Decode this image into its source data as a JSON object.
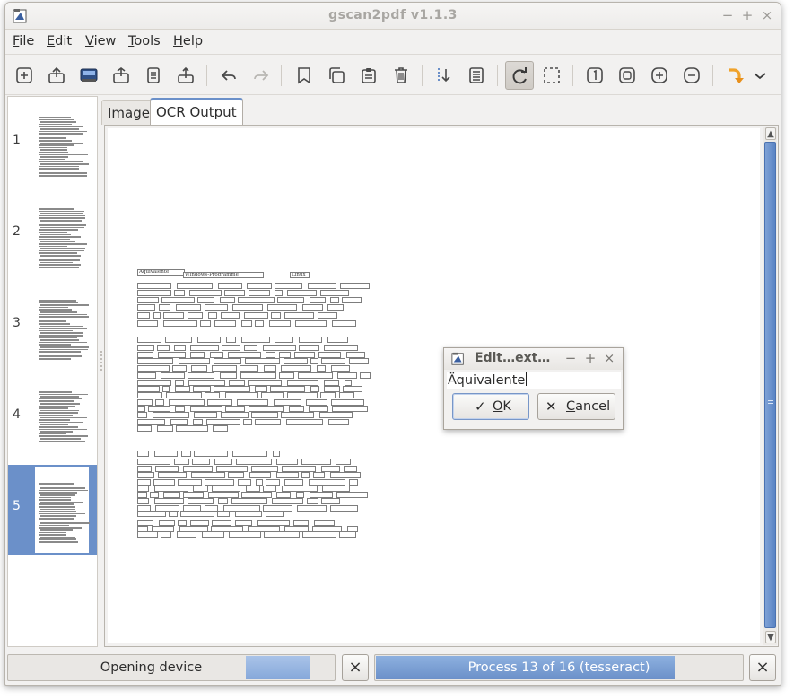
{
  "window": {
    "title": "gscan2pdf v1.1.3",
    "controls": {
      "minimize": "−",
      "maximize": "+",
      "close": "×"
    }
  },
  "menubar": {
    "items": [
      {
        "label": "File",
        "mnemonic": "F",
        "rest": "ile"
      },
      {
        "label": "Edit",
        "mnemonic": "E",
        "rest": "dit"
      },
      {
        "label": "View",
        "mnemonic": "V",
        "rest": "iew"
      },
      {
        "label": "Tools",
        "mnemonic": "T",
        "rest": "ools"
      },
      {
        "label": "Help",
        "mnemonic": "H",
        "rest": "elp"
      }
    ]
  },
  "toolbar": {
    "buttons": [
      {
        "name": "new-icon"
      },
      {
        "name": "open-icon"
      },
      {
        "name": "scan-icon"
      },
      {
        "name": "save-icon"
      },
      {
        "name": "email-icon"
      },
      {
        "name": "print-icon"
      },
      {
        "name": "undo-icon"
      },
      {
        "name": "redo-icon"
      },
      {
        "name": "cut-icon"
      },
      {
        "name": "copy-icon"
      },
      {
        "name": "paste-icon"
      },
      {
        "name": "delete-icon"
      },
      {
        "name": "renumber-icon"
      },
      {
        "name": "select-all-icon"
      },
      {
        "name": "rotate-icon",
        "active": true
      },
      {
        "name": "crop-select-icon"
      },
      {
        "name": "zoom-100-icon"
      },
      {
        "name": "zoom-fit-icon"
      },
      {
        "name": "zoom-in-icon"
      },
      {
        "name": "zoom-out-icon"
      },
      {
        "name": "rotate-arrow-icon"
      },
      {
        "name": "overflow-chevron-icon"
      }
    ]
  },
  "thumbnails": {
    "pages": [
      {
        "number": "1"
      },
      {
        "number": "2"
      },
      {
        "number": "3"
      },
      {
        "number": "4"
      },
      {
        "number": "5",
        "selected": true
      }
    ]
  },
  "tabs": [
    {
      "label": "Image",
      "active": false
    },
    {
      "label": "OCR Output",
      "active": true
    }
  ],
  "ocr": {
    "labeled_words": [
      "Äquivalente",
      "Windows-Programme",
      "Linux"
    ]
  },
  "dialog": {
    "title": "Edit…ext…",
    "text_value": "Äquivalente",
    "ok_mnemonic": "O",
    "ok_rest": "K",
    "cancel_mnemonic": "C",
    "cancel_rest": "ancel",
    "controls": {
      "minimize": "−",
      "maximize": "+",
      "close": "×"
    }
  },
  "statusbar": {
    "left_text": "Opening device",
    "left_close": "×",
    "right_text": "Process 13 of 16 (tesseract)",
    "right_progress": 0.8125,
    "right_close": "×"
  },
  "colors": {
    "accent": "#6b90c9",
    "selection": "#6b90c9",
    "progress": "#7fa2d6"
  }
}
